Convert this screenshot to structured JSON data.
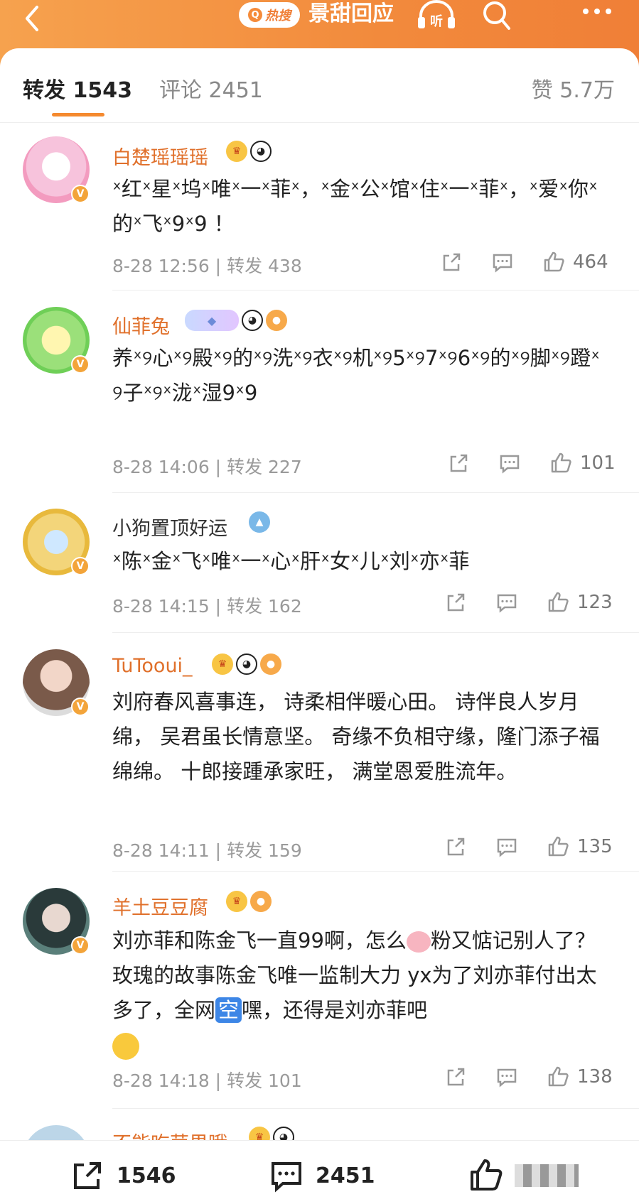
{
  "header": {
    "hot_label": "热搜",
    "topic": "景甜回应",
    "listen_label": "听"
  },
  "tabs": {
    "repost": "转发 1543",
    "comment": "评论 2451",
    "like": "赞 5.7万"
  },
  "comments": [
    {
      "user": "白楚瑶瑶瑶",
      "text": "ˣ红ˣ星ˣ坞ˣ唯ˣ一ˣ菲ˣ，ˣ金ˣ公ˣ馆ˣ住ˣ一ˣ菲ˣ，ˣ爱ˣ你ˣ的ˣ飞ˣ9ˣ9 ！",
      "time": "8-28 12:56",
      "repost": "转发 438",
      "likes": "464"
    },
    {
      "user": "仙菲兔",
      "text": "养ˣ୨心ˣ୨殿ˣ୨的ˣ୨洗ˣ୨衣ˣ୨机ˣ୨5ˣ୨7ˣ୨6ˣ୨的ˣ୨脚ˣ୨蹬ˣ୨子ˣ୨ˣ泷ˣ湿9ˣ9",
      "time": "8-28 14:06",
      "repost": "转发 227",
      "likes": "101"
    },
    {
      "user": "小狗置顶好运",
      "text": "ˣ陈ˣ金ˣ飞ˣ唯ˣ一ˣ心ˣ肝ˣ女ˣ儿ˣ刘ˣ亦ˣ菲",
      "time": "8-28 14:15",
      "repost": "转发 162",
      "likes": "123"
    },
    {
      "user": "TuTooui_",
      "text": "刘府春风喜事连， 诗柔相伴暖心田。 诗伴良人岁月绵， 吴君虽长情意坚。 奇缘不负相守缘，隆门添子福绵绵。 十郎接踵承家旺， 满堂恩爱胜流年。",
      "time": "8-28 14:11",
      "repost": "转发 159",
      "likes": "135"
    },
    {
      "user": "羊土豆豆腐",
      "text_a": "刘亦菲和陈金飞一直99啊，怎么",
      "text_b": "粉又惦记别人了？玫瑰的故事陈金飞唯一监制大力 yx为了刘亦菲付出太多了，全网",
      "kong": "空",
      "text_c": "嘿，还得是刘亦菲吧",
      "time": "8-28 14:18",
      "repost": "转发 101",
      "likes": "138"
    },
    {
      "user": "不能吃苹果哦"
    }
  ],
  "bottom": {
    "repost": "1546",
    "comment": "2451"
  },
  "colors": {
    "accent": "#f58a2f",
    "username": "#e0702b",
    "username_plain": "#333333"
  },
  "icons": [
    "back-icon",
    "hot-search-icon",
    "headphone-icon",
    "search-icon",
    "more-icon",
    "share-icon",
    "comment-icon",
    "like-icon",
    "verified-icon"
  ]
}
